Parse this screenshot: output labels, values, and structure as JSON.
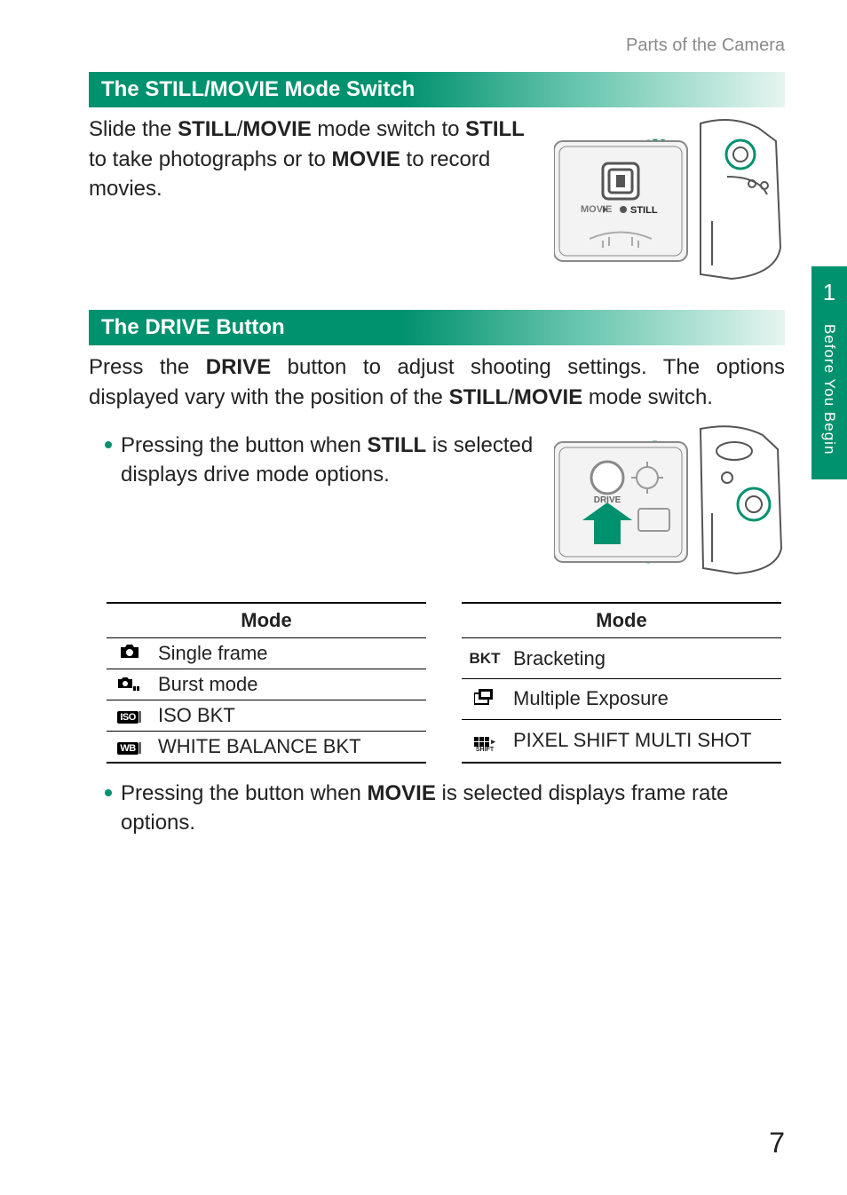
{
  "breadcrumb": "Parts of the Camera",
  "sidebar": {
    "chapter_num": "1",
    "chapter_title": "Before You Begin"
  },
  "page_number": "7",
  "section1": {
    "title": "The STILL/MOVIE Mode Switch",
    "p1_a": "Slide the ",
    "p1_b": "STILL",
    "p1_c": "/",
    "p1_d": "MOVIE",
    "p1_e": " mode switch to ",
    "p1_f": "STILL",
    "p1_g": " to take photographs or to ",
    "p1_h": "MOVIE",
    "p1_i": " to record movies.",
    "illus_movie": "MOVIE",
    "illus_still": "STILL"
  },
  "section2": {
    "title": "The DRIVE Button",
    "p1_a": "Press the ",
    "p1_b": "DRIVE",
    "p1_c": " button to adjust shooting settings. The options displayed vary with the position of the ",
    "p1_d": "STILL",
    "p1_e": "/",
    "p1_f": "MOVIE",
    "p1_g": " mode switch.",
    "illus_drive": "DRIVE",
    "bullet1_a": "Pressing the button when ",
    "bullet1_b": "STILL",
    "bullet1_c": " is selected displays drive mode options.",
    "table_header": "Mode",
    "left_rows": [
      {
        "icon_name": "camera-icon",
        "label": "Single frame"
      },
      {
        "icon_name": "burst-icon",
        "label": "Burst mode"
      },
      {
        "icon_name": "iso-bkt-icon",
        "icon_text": "ISO",
        "label": "ISO BKT"
      },
      {
        "icon_name": "wb-bkt-icon",
        "icon_text": "WB",
        "label": "WHITE BALANCE BKT"
      }
    ],
    "right_rows": [
      {
        "icon_name": "bkt-icon",
        "icon_text": "BKT",
        "label": "Bracketing"
      },
      {
        "icon_name": "multi-exposure-icon",
        "label": "Multiple Exposure"
      },
      {
        "icon_name": "pixel-shift-icon",
        "icon_sub": "SHIFT",
        "label": "PIXEL SHIFT MULTI SHOT"
      }
    ],
    "bullet2_a": "Pressing the button when ",
    "bullet2_b": "MOVIE",
    "bullet2_c": " is selected displays frame rate options."
  }
}
